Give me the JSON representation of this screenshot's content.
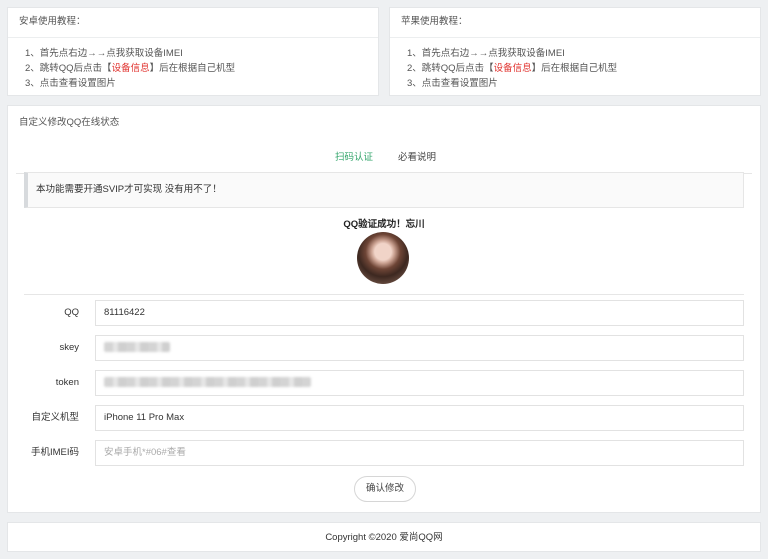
{
  "android_card": {
    "title": "安卓使用教程：",
    "line1": "1、首先点右边→→点我获取设备IMEI",
    "line2_prefix": "2、跳转QQ后点击【",
    "line2_highlight": "设备信息",
    "line2_suffix": "】后在根据自己机型",
    "line3": "3、点击查看设置图片"
  },
  "apple_card": {
    "title": "苹果使用教程：",
    "line1": "1、首先点右边→→点我获取设备IMEI",
    "line2_prefix": "2、跳转QQ后点击【",
    "line2_highlight": "设备信息",
    "line2_suffix": "】后在根据自己机型",
    "line3": "3、点击查看设置图片"
  },
  "main": {
    "title": "自定义修改QQ在线状态",
    "tabs": [
      {
        "label": "扫码认证",
        "active": true
      },
      {
        "label": "必看说明",
        "active": false
      }
    ],
    "notice": "本功能需要开通SVIP才可实现 没有用不了！",
    "verify_message": "QQ验证成功！忘川",
    "form": {
      "qq": {
        "label": "QQ",
        "value": "81116422"
      },
      "skey": {
        "label": "skey",
        "value": ""
      },
      "token": {
        "label": "token",
        "value": ""
      },
      "model": {
        "label": "自定义机型",
        "value": "iPhone 11 Pro Max"
      },
      "imei": {
        "label": "手机IMEI码",
        "placeholder": "安卓手机*#06#查看"
      }
    },
    "submit_label": "确认修改"
  },
  "footer": {
    "copyright": "Copyright ©2020 爱尚QQ网"
  },
  "colors": {
    "accent": "#33a56b",
    "highlight": "#e0322e"
  }
}
